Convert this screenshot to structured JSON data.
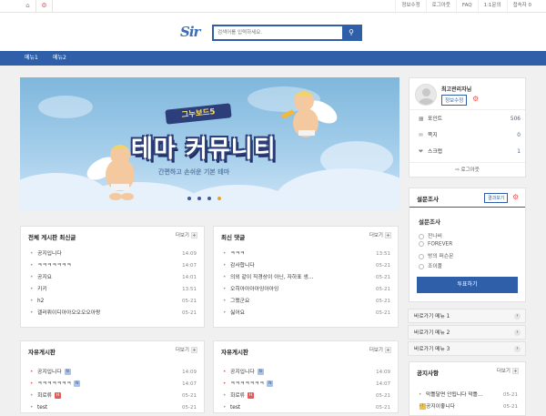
{
  "topbar": {
    "links": [
      "정보수정",
      "로그아웃",
      "FAQ",
      "1:1문의",
      "접속자 0"
    ]
  },
  "header": {
    "logo": "Sir",
    "search_placeholder": "검색어를 입력하세요."
  },
  "nav": {
    "items": [
      "메뉴1",
      "메뉴2"
    ]
  },
  "banner": {
    "tag": "그누보드5",
    "title": "테마 커뮤니티",
    "subtitle": "간편하고 손쉬운 기본 테마",
    "dots_active": 3
  },
  "profile": {
    "name": "최고관리자님",
    "edit_label": "정보수정",
    "rows": [
      {
        "icon": "coin-icon",
        "label": "포인트",
        "value": "506"
      },
      {
        "icon": "memo-icon",
        "label": "쪽지",
        "value": "0"
      },
      {
        "icon": "scrap-icon",
        "label": "스크랩",
        "value": "1"
      }
    ],
    "logout": "로그아웃"
  },
  "poll": {
    "title": "설문조사",
    "results_label": "결과보기",
    "question": "설문조사",
    "options": [
      "잔나비",
      "FOREVER",
      "방의 퍼슨몬",
      "조이풀"
    ],
    "vote_label": "투표하기"
  },
  "quicklinks": [
    "바로가기 메뉴 1",
    "바로가기 메뉴 2",
    "바로가기 메뉴 3"
  ],
  "more_label": "더보기",
  "boards": [
    {
      "title": "전체 게시판 최신글",
      "rows": [
        {
          "t": "공지입니다",
          "d": "14:09"
        },
        {
          "t": "ㅋㅋㅋㅋㅋㅋㅋ",
          "d": "14:07"
        },
        {
          "t": "공지요",
          "d": "14:01"
        },
        {
          "t": "키키",
          "d": "13:51"
        },
        {
          "t": "h2",
          "d": "05-21"
        },
        {
          "t": "갤러뤼이디아아오오오오아랑",
          "d": "05-21"
        }
      ]
    },
    {
      "title": "최신 댓글",
      "rows": [
        {
          "t": "ㅋㅋㅋ",
          "d": "13:51"
        },
        {
          "t": "감사합니다",
          "d": "05-21"
        },
        {
          "t": "의외 같이 직경상이 아닌, 자하표 생…",
          "d": "05-21"
        },
        {
          "t": "오히아아아아잉아아잉",
          "d": "05-21"
        },
        {
          "t": "그랬군요",
          "d": "05-21"
        },
        {
          "t": "싫어요",
          "d": "05-21"
        }
      ]
    },
    {
      "title": "자유게시판",
      "rows": [
        {
          "t": "공지입니다",
          "d": "14:09",
          "b": "N"
        },
        {
          "t": "ㅋㅋㅋㅋㅋㅋㅋ",
          "d": "14:07",
          "b": "N"
        },
        {
          "t": "회로류",
          "d": "05-21",
          "b": "H"
        },
        {
          "t": "test",
          "d": "05-21"
        }
      ]
    },
    {
      "title": "자유게시판",
      "rows": [
        {
          "t": "공지입니다",
          "d": "14:09",
          "b": "N"
        },
        {
          "t": "ㅋㅋㅋㅋㅋㅋㅋ",
          "d": "14:07",
          "b": "N"
        },
        {
          "t": "회로류",
          "d": "05-21",
          "b": "H"
        },
        {
          "t": "test",
          "d": "05-21"
        }
      ]
    }
  ],
  "notice": {
    "title": "공지사항",
    "rows": [
      {
        "t": "막틀달면 안됩니다 막틀…",
        "d": "05-21"
      },
      {
        "t": "공지이좋니다",
        "d": "05-21"
      }
    ]
  },
  "colors": {
    "brand": "#2f5fa8",
    "alert": "#e85a5a"
  }
}
